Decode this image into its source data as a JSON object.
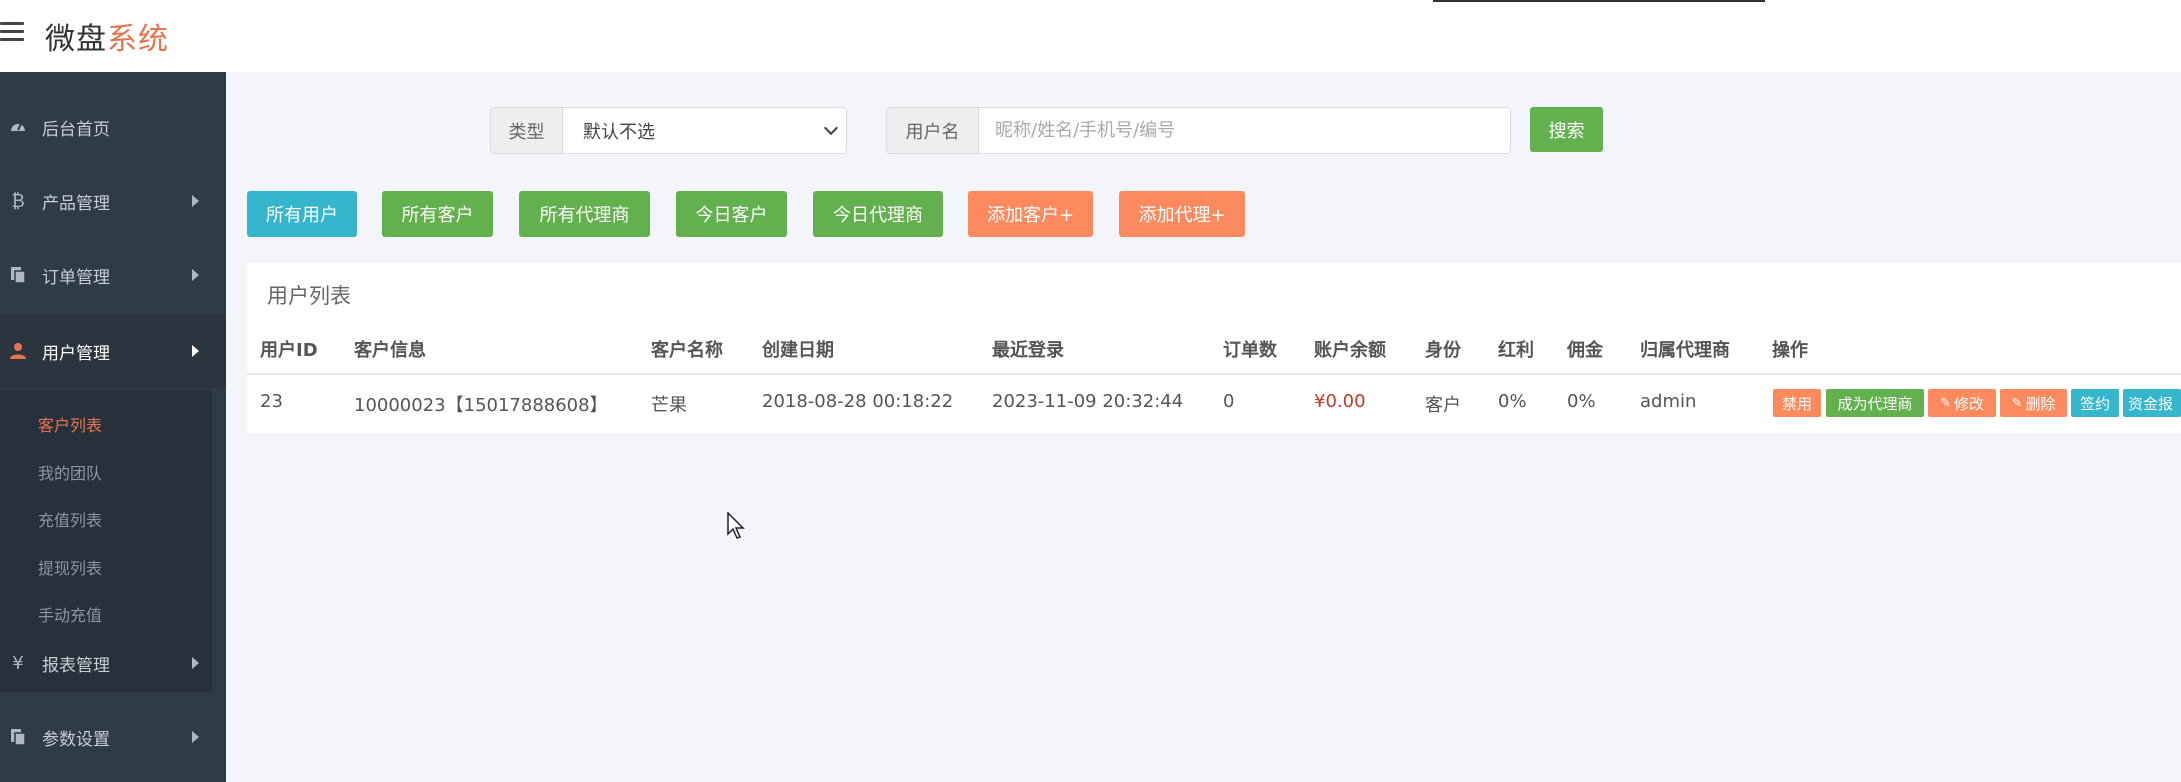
{
  "brand": {
    "name_main": "微盘",
    "name_accent": "系统"
  },
  "sidebar": {
    "items": [
      {
        "label": "后台首页",
        "icon": "dashboard-icon"
      },
      {
        "label": "产品管理",
        "icon": "bitcoin-icon"
      },
      {
        "label": "订单管理",
        "icon": "copy-icon"
      },
      {
        "label": "用户管理",
        "icon": "user-icon"
      },
      {
        "label": "报表管理",
        "icon": "yen-icon"
      },
      {
        "label": "参数设置",
        "icon": "copy-icon"
      }
    ],
    "sub_items": [
      "客户列表",
      "我的团队",
      "充值列表",
      "提现列表",
      "手动充值"
    ]
  },
  "search": {
    "type_label": "类型",
    "type_value": "默认不选",
    "username_label": "用户名",
    "username_placeholder": "昵称/姓名/手机号/编号",
    "username_value": "",
    "search_button": "搜索"
  },
  "filters": [
    "所有用户",
    "所有客户",
    "所有代理商",
    "今日客户",
    "今日代理商",
    "添加客户+",
    "添加代理+"
  ],
  "table": {
    "title": "用户列表",
    "headers": [
      "用户ID",
      "客户信息",
      "客户名称",
      "创建日期",
      "最近登录",
      "订单数",
      "账户余额",
      "身份",
      "红利",
      "佣金",
      "归属代理商",
      "操作"
    ],
    "rows": [
      {
        "id": "23",
        "info": "10000023【15017888608】",
        "name": "芒果",
        "created": "2018-08-28 00:18:22",
        "last_login": "2023-11-09 20:32:44",
        "orders": "0",
        "balance": "¥0.00",
        "role": "客户",
        "dividend": "0%",
        "commission": "0%",
        "agent": "admin",
        "actions": [
          "禁用",
          "成为代理商",
          "修改",
          "删除",
          "签约",
          "资金报"
        ]
      }
    ]
  },
  "colors": {
    "sidebar_bg": "#2f3b48",
    "accent": "#e9734e",
    "green": "#62b04e",
    "cyan": "#35b6cc",
    "orange": "#fd8a5e"
  }
}
